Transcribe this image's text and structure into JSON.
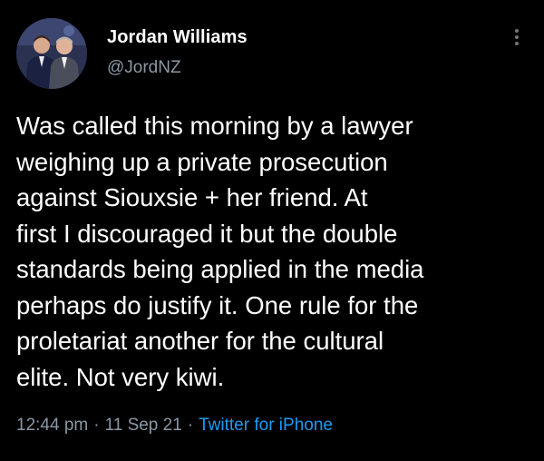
{
  "author": {
    "display_name": "Jordan Williams",
    "handle": "@JordNZ",
    "avatar_icon": "profile-photo"
  },
  "menu": {
    "icon": "more-vertical-icon"
  },
  "tweet": {
    "text": "Was called this morning by a lawyer\nweighing up a private prosecution\nagainst Siouxsie + her friend. At\nfirst I discouraged it but the double\nstandards being applied in the media\nperhaps do justify it. One rule for the\nproletariat another for the cultural\nelite. Not very kiwi.",
    "time": "12:44 pm",
    "separator": "·",
    "date": "11 Sep 21",
    "source": "Twitter for iPhone"
  },
  "colors": {
    "background": "#000000",
    "primary_text": "#ffffff",
    "secondary_text": "#8b98a5",
    "link": "#1d9bf0"
  }
}
